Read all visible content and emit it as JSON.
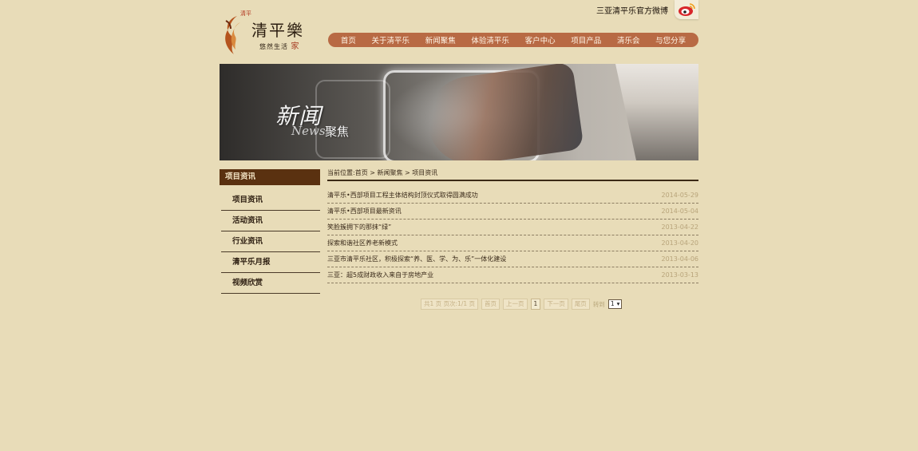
{
  "header": {
    "logo": {
      "name": "清平樂",
      "tagline": "悠然生活",
      "tagline_accent": "家",
      "stamp": "清平"
    },
    "weibo_text": "三亚清平乐官方微博",
    "nav": [
      "首页",
      "关于清平乐",
      "新闻聚焦",
      "体验清平乐",
      "客户中心",
      "项目产品",
      "清乐会",
      "与您分享"
    ]
  },
  "banner": {
    "title": "新闻",
    "subtitle_en": "News",
    "subtitle_cn": "聚焦"
  },
  "sidebar": {
    "heading": "项目资讯",
    "items": [
      "项目资讯",
      "活动资讯",
      "行业资讯",
      "清平乐月报",
      "视频欣赏"
    ]
  },
  "breadcrumb": "当前位置:首页 > 新闻聚焦 > 项目资讯",
  "news": [
    {
      "title": "清平乐•西部项目工程主体结构封顶仪式取得圆满成功",
      "date": "2014-05-29"
    },
    {
      "title": "清平乐•西部项目最新资讯",
      "date": "2014-05-04"
    },
    {
      "title": "笑脸簇拥下的那抹“绿”",
      "date": "2013-04-22"
    },
    {
      "title": "探索和谐社区养老新模式",
      "date": "2013-04-20"
    },
    {
      "title": "三亚市清平乐社区，积极探索“养、医、学、为、乐”一体化建设",
      "date": "2013-04-06"
    },
    {
      "title": "三亚：超5成财政收入来自于房地产业",
      "date": "2013-03-13"
    }
  ],
  "pager": {
    "summary": "共1 页 页次:1/1 页",
    "first": "首页",
    "prev": "上一页",
    "current": "1",
    "next": "下一页",
    "last": "尾页",
    "jump": "转到",
    "select_value": "1"
  },
  "colors": {
    "background": "#e8dcb8",
    "nav": "#b86a44",
    "sidebar_head": "#5a3110"
  }
}
